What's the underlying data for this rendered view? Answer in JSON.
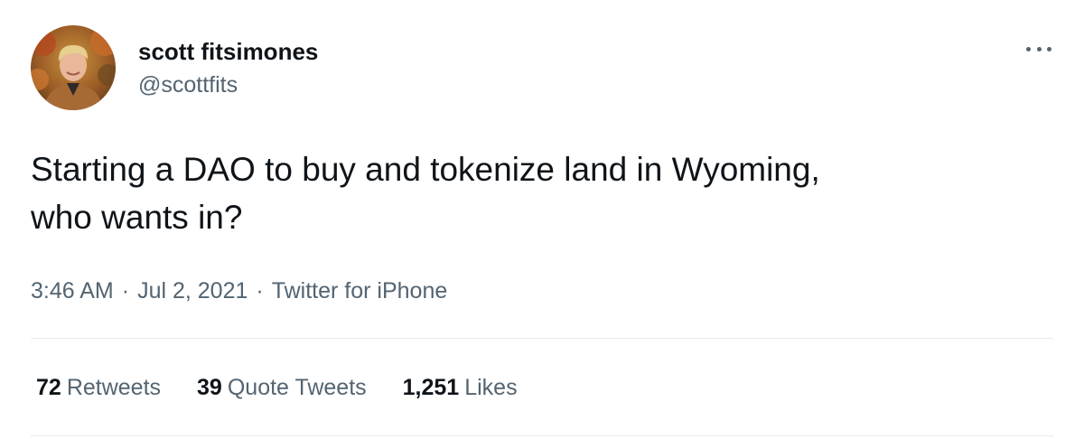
{
  "author": {
    "display_name": "scott fitsimones",
    "handle": "@scottfits"
  },
  "tweet": {
    "text_line1": "Starting a DAO to buy and tokenize land in Wyoming,",
    "text_line2": "who wants in?"
  },
  "meta": {
    "time": "3:46 AM",
    "separator": "·",
    "date": "Jul 2, 2021",
    "source": "Twitter for iPhone"
  },
  "stats": {
    "retweets": {
      "count": "72",
      "label": "Retweets"
    },
    "quote_tweets": {
      "count": "39",
      "label": "Quote Tweets"
    },
    "likes": {
      "count": "1,251",
      "label": "Likes"
    }
  },
  "colors": {
    "primary_text": "#0f1419",
    "secondary_text": "#536471",
    "divider": "#e6ecf0"
  },
  "icons": {
    "more": "more-horizontal-icon"
  }
}
